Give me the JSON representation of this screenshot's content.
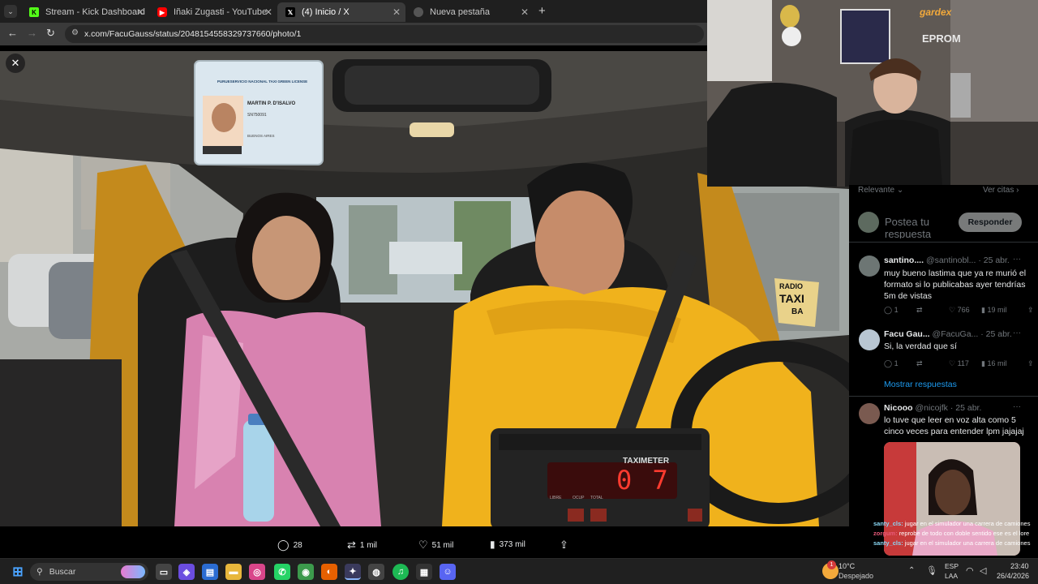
{
  "browser": {
    "tabs": [
      {
        "label": "Stream - Kick Dashboard",
        "icon": "kick-icon",
        "color": "#53fc18"
      },
      {
        "label": "Iñaki Zugasti - YouTube",
        "icon": "youtube-icon",
        "color": "#ff0000"
      },
      {
        "label": "(4) Inicio / X",
        "icon": "x-icon",
        "color": "#ffffff"
      },
      {
        "label": "Nueva pestaña",
        "icon": "chrome-icon",
        "color": "#cccccc"
      }
    ],
    "url": "x.com/FacuGauss/status/2048154558329737660/photo/1"
  },
  "photo": {
    "license_card": {
      "header": "PURUESERVICIO NACIONAL TAXI GREEN LICENSE",
      "name": "MARTIN P. D'ISALVO",
      "number": "SN750091",
      "stamp": "BUENOS AIRES"
    },
    "taximeter": {
      "label": "TAXIMETER",
      "display": "0 7",
      "buttons": [
        "LIBRE",
        "OCUP",
        "TOTAL"
      ]
    },
    "sign": {
      "line1": "RADIO",
      "line2": "TAXI",
      "line3": "BA"
    }
  },
  "actions": {
    "replies": "28",
    "reposts": "1 mil",
    "likes": "51 mil",
    "views": "373 mil"
  },
  "webcam": {
    "brand1": "gardex",
    "brand2": "EPROM"
  },
  "replies_panel": {
    "sort_label": "Relevante",
    "quotes_label": "Ver citas",
    "compose_placeholder": "Postea tu respuesta",
    "reply_button": "Responder",
    "show_replies": "Mostrar respuestas",
    "items": [
      {
        "name": "santino....",
        "handle": "@santinobl...",
        "date": "· 25 abr.",
        "text": "muy bueno lastima que ya re murió el formato si lo publicabas ayer tendrías 5m de vistas",
        "replies": "1",
        "likes": "766",
        "views": "19 mil"
      },
      {
        "name": "Facu Gau...",
        "handle": "@FacuGa...",
        "date": "· 25 abr.",
        "text": "Si, la verdad que sí",
        "replies": "1",
        "likes": "117",
        "views": "16 mil"
      },
      {
        "name": "Nicooo",
        "handle": "@nicojfk",
        "date": "· 25 abr.",
        "text": "lo tuve que leer en voz alta como 5 cinco veces para entender lpm jajajaj",
        "replies": "",
        "likes": "",
        "views": ""
      }
    ],
    "chat_overlay": [
      {
        "user": "santy_cls:",
        "text": "jugar en el simulador una carrera de camiones"
      },
      {
        "user": "zorgum:",
        "text": "reprobe de todo con doble sentido ese es el lore"
      },
      {
        "user": "santy_cls:",
        "text": "jugar en el simulador una carrera de camiones"
      }
    ]
  },
  "taskbar": {
    "search_label": "Buscar",
    "weather_temp": "10°C",
    "weather_desc": "Despejado",
    "lang1": "ESP",
    "lang2": "LAA",
    "time": "23:40",
    "date": "26/4/2026",
    "notif_badge": "1"
  }
}
